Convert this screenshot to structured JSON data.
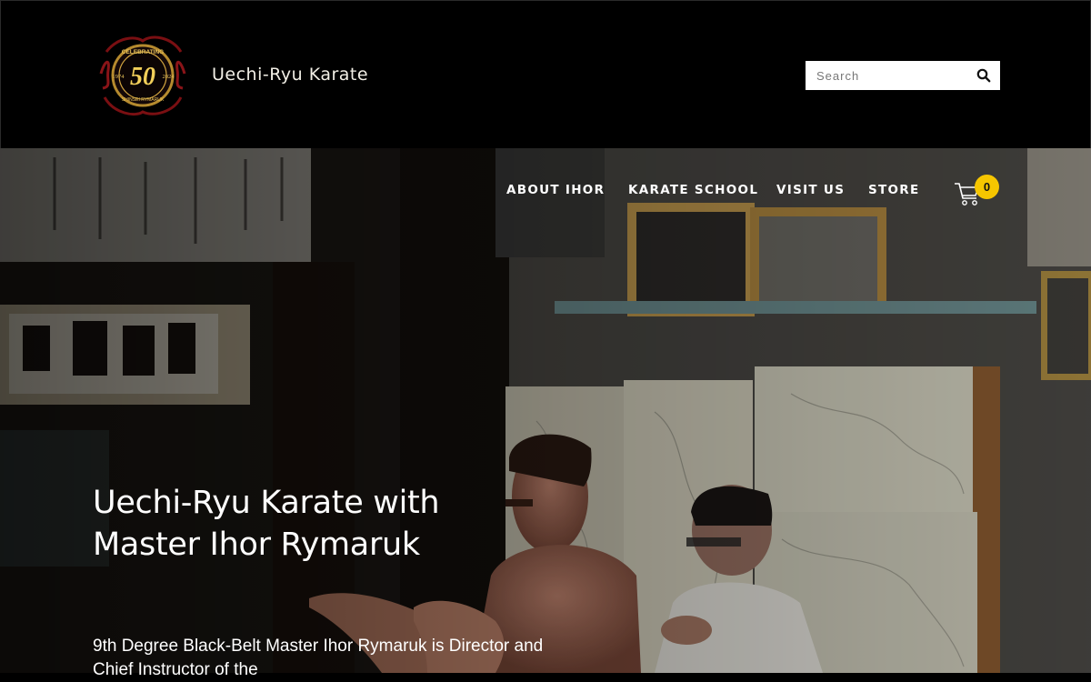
{
  "header": {
    "logo": {
      "top_text": "CELEBRATING",
      "year_left": "1974",
      "number": "50",
      "year_right": "2024",
      "bottom_text": "SHINSEI RYMARUK",
      "icon": "anniversary-seal-logo"
    },
    "site_title": "Uechi-Ryu Karate",
    "search": {
      "placeholder": "Search",
      "icon": "search-icon"
    }
  },
  "nav": {
    "items": [
      {
        "label": "ABOUT IHOR"
      },
      {
        "label": "KARATE SCHOOL"
      },
      {
        "label": "VISIT US"
      },
      {
        "label": "STORE"
      }
    ],
    "cart": {
      "icon": "cart-icon",
      "count": "0"
    }
  },
  "hero": {
    "title_line1": "Uechi-Ryu Karate with",
    "title_line2": "Master Ihor Rymaruk",
    "description": "9th Degree Black-Belt Master Ihor Rymaruk is Director and Chief Instructor of the"
  },
  "colors": {
    "background": "#000000",
    "accent_badge": "#f6c600",
    "text": "#ffffff"
  }
}
